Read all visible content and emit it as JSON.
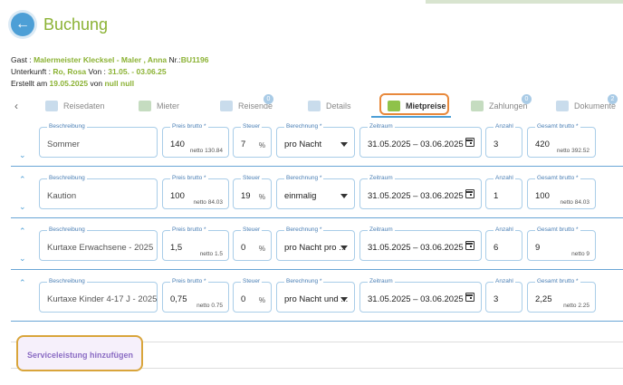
{
  "header": {
    "title": "Buchung"
  },
  "info": {
    "gast_label": "Gast :",
    "gast_value": "Malermeister Klecksel - Maler , Anna",
    "nr_label": "Nr.:",
    "nr_value": "BU1196",
    "unterkunft_label": "Unterkunft :",
    "unterkunft_value": "Ro, Rosa",
    "von_label": "Von :",
    "von_value": "31.05. - 03.06.25",
    "erstellt_label": "Erstellt am",
    "erstellt_value": "19.05.2025",
    "von2_label": "von",
    "von2_value": "null null"
  },
  "tabs": [
    {
      "label": "Reisedaten",
      "badge": ""
    },
    {
      "label": "Mieter",
      "badge": ""
    },
    {
      "label": "Reisende",
      "badge": "0"
    },
    {
      "label": "Details",
      "badge": ""
    },
    {
      "label": "Mietpreise",
      "badge": ""
    },
    {
      "label": "Zahlungen",
      "badge": "0"
    },
    {
      "label": "Dokumente",
      "badge": "2"
    }
  ],
  "labels": {
    "beschreibung": "Beschreibung",
    "preis_brutto": "Preis brutto *",
    "steuer": "Steuer",
    "berechnung": "Berechnung *",
    "zeitraum": "Zeitraum",
    "anzahl": "Anzahl",
    "gesamt_brutto": "Gesamt brutto *",
    "percent": "%"
  },
  "rows": [
    {
      "beschreibung": "Sommer",
      "preis": "140",
      "preis_netto": "netto 130.84",
      "steuer": "7",
      "berechnung": "pro Nacht",
      "zeitraum": "31.05.2025 – 03.06.2025",
      "anzahl": "3",
      "gesamt": "420",
      "gesamt_netto": "netto 392.52"
    },
    {
      "beschreibung": "Kaution",
      "preis": "100",
      "preis_netto": "netto 84.03",
      "steuer": "19",
      "berechnung": "einmalig",
      "zeitraum": "31.05.2025 – 03.06.2025",
      "anzahl": "1",
      "gesamt": "100",
      "gesamt_netto": "netto 84.03"
    },
    {
      "beschreibung": "Kurtaxe Erwachsene - 2025",
      "preis": "1,5",
      "preis_netto": "netto 1.5",
      "steuer": "0",
      "berechnung": "pro Nacht pro ...",
      "zeitraum": "31.05.2025 – 03.06.2025",
      "anzahl": "6",
      "gesamt": "9",
      "gesamt_netto": "netto 9"
    },
    {
      "beschreibung": "Kurtaxe Kinder 4-17 J - 2025",
      "preis": "0,75",
      "preis_netto": "netto 0.75",
      "steuer": "0",
      "berechnung": "pro Nacht und ...",
      "zeitraum": "31.05.2025 – 03.06.2025",
      "anzahl": "3",
      "gesamt": "2,25",
      "gesamt_netto": "netto 2.25"
    }
  ],
  "actions": {
    "add_service": "Serviceleistung hinzufügen"
  },
  "colors": {
    "accent_green": "#8bb234",
    "accent_blue": "#4d9fd6",
    "highlight_orange": "#e8893c",
    "highlight_gold": "#d9a53b"
  }
}
